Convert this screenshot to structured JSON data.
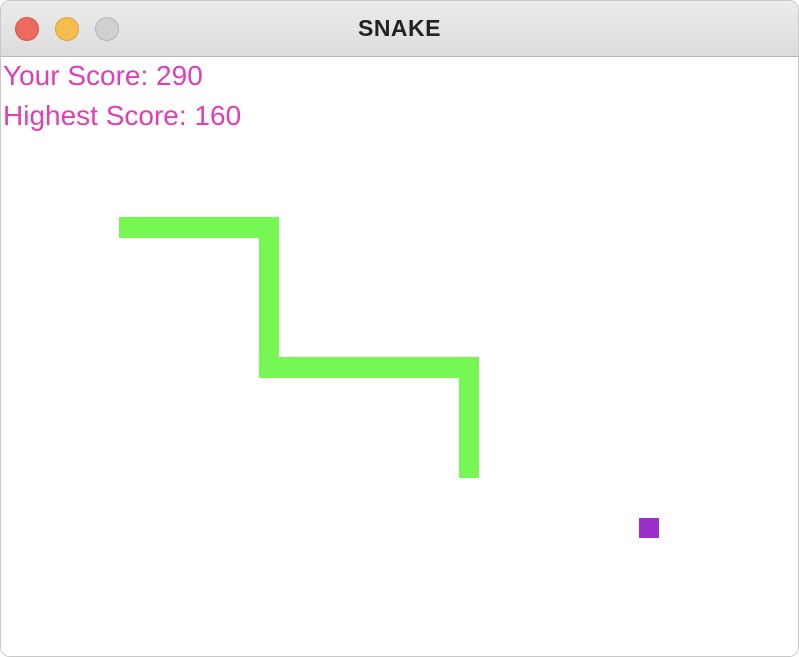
{
  "window": {
    "title": "SNAKE"
  },
  "scores": {
    "your_score": "Your Score: 290",
    "highest_score": "Highest Score: 160"
  },
  "colors": {
    "score_text": "#e03fb3",
    "snake": "#77f753",
    "food": "#9b2fc9"
  }
}
